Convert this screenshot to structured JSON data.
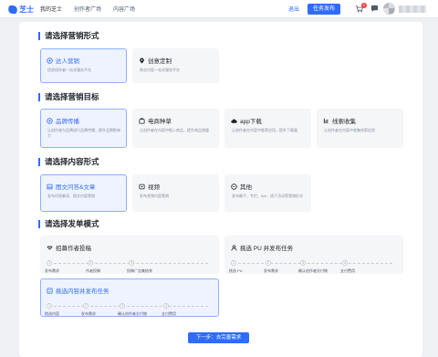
{
  "topbar": {
    "logo": "芝士",
    "nav": [
      "我的芝士",
      "创作者广场",
      "内容广场"
    ],
    "exit_label": "退出",
    "publish_label": "任务发布",
    "cart_count": "0"
  },
  "sections": {
    "form": {
      "title": "请选择营销形式"
    },
    "goal": {
      "title": "请选择营销目标"
    },
    "content": {
      "title": "请选择内容形式"
    },
    "dispatch": {
      "title": "请选择发单模式"
    }
  },
  "form_cards": [
    {
      "title": "达人营销",
      "desc": "优质创作者一站式服务平台",
      "selected": true,
      "icon": "target-icon"
    },
    {
      "title": "创意定制",
      "desc": "商业内容一站式服务平台",
      "selected": false,
      "icon": "pin-icon"
    }
  ],
  "goal_cards": [
    {
      "title": "品牌传播",
      "desc": "让创作者为品牌进行品牌传播，提升品牌影响力",
      "selected": true,
      "icon": "target-icon"
    },
    {
      "title": "电商种草",
      "desc": "让创作者在内容中植入商品，提升商品销量",
      "selected": false,
      "icon": "shop-icon"
    },
    {
      "title": "app下载",
      "desc": "让创作者在内容中推荐应用，提升下载量",
      "selected": false,
      "icon": "cloud-icon"
    },
    {
      "title": "线索收集",
      "desc": "让创作者在内容中收集线索信息",
      "selected": false,
      "icon": "funnel-icon"
    }
  ],
  "content_cards": [
    {
      "title": "图文问答&文章",
      "desc": "发布问答解读、图文内容营销",
      "selected": true,
      "icon": "image-icon"
    },
    {
      "title": "视频",
      "desc": "发布视频内容营销",
      "selected": false,
      "icon": "video-icon"
    },
    {
      "title": "其他",
      "desc": "发布圈子、专栏、live、线下活动等营销形式",
      "selected": false,
      "icon": "more-icon"
    }
  ],
  "dispatch_cards": [
    {
      "title": "招募作者投稿",
      "selected": false,
      "icon": "handshake-icon",
      "steps": [
        "发布需求",
        "作者投稿",
        "投稿广告集结束"
      ]
    },
    {
      "title": "挑选 PU 并发布任务",
      "selected": false,
      "icon": "user-icon",
      "steps": [
        "挑选 PU",
        "发布需求",
        "确认创作者交付物",
        "支付费用"
      ]
    },
    {
      "title": "挑选内容并发布任务",
      "selected": true,
      "icon": "list-icon",
      "steps": [
        "挑选内容",
        "发布需求",
        "确认创作者交付物",
        "支付费用"
      ]
    }
  ],
  "next_label": "下一步：去完善需求",
  "colors": {
    "accent": "#2f6bff",
    "selected_bg": "#eef3ff",
    "card_bg": "#f5f6f8"
  }
}
